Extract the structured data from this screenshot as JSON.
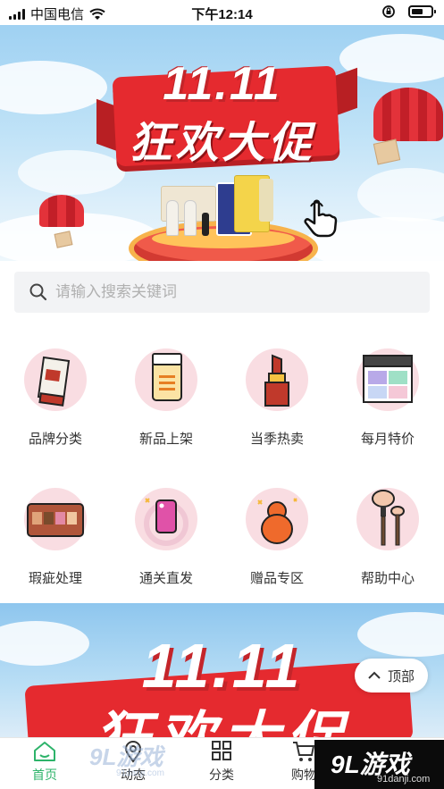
{
  "status_bar": {
    "carrier": "中国电信",
    "time": "下午12:14"
  },
  "banner": {
    "title_line1": "11.11",
    "title_line2": "狂欢大促",
    "active_dot": 0,
    "dot_count": 5
  },
  "search": {
    "placeholder": "请输入搜索关键词"
  },
  "categories": [
    {
      "label": "品牌分类",
      "icon": "sunscreen-tube-icon"
    },
    {
      "label": "新品上架",
      "icon": "cream-bottle-icon"
    },
    {
      "label": "当季热卖",
      "icon": "lipstick-icon"
    },
    {
      "label": "每月特价",
      "icon": "eyeshadow-palette-icon"
    },
    {
      "label": "瑕疵处理",
      "icon": "makeup-palette-icon"
    },
    {
      "label": "通关直发",
      "icon": "phone-case-icon"
    },
    {
      "label": "赠品专区",
      "icon": "beauty-sponge-icon"
    },
    {
      "label": "帮助中心",
      "icon": "makeup-brush-icon"
    }
  ],
  "banner2": {
    "title_line1": "11.11",
    "title_line2": "狂欢大促"
  },
  "back_to_top": {
    "label": "顶部"
  },
  "tabbar": [
    {
      "label": "首页",
      "icon": "home-icon",
      "active": true
    },
    {
      "label": "动态",
      "icon": "location-pin-icon",
      "active": false
    },
    {
      "label": "分类",
      "icon": "grid-icon",
      "active": false
    },
    {
      "label": "购物",
      "icon": "cart-icon",
      "active": false
    }
  ],
  "watermark": {
    "logo_text": "9L游戏",
    "site": "91danji.com"
  },
  "colors": {
    "accent_green": "#2db36a",
    "banner_red": "#e52a2f",
    "icon_bg_pink": "#f9dde2"
  }
}
